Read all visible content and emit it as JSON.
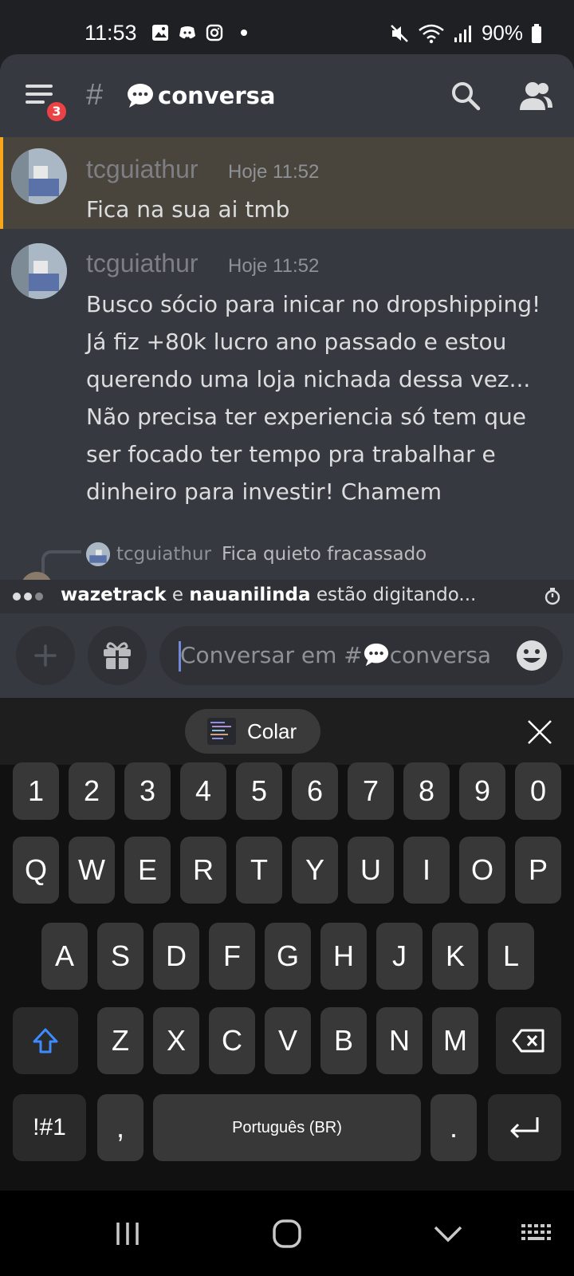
{
  "status_bar": {
    "time": "11:53",
    "battery": "90%"
  },
  "header": {
    "badge_count": "3",
    "hash": "#",
    "channel_name": "conversa"
  },
  "messages": [
    {
      "author": "tcguiathur",
      "time": "Hoje 11:52",
      "text": "Fica na sua ai tmb",
      "highlighted": true
    },
    {
      "author": "tcguiathur",
      "time": "Hoje 11:52",
      "lines": [
        "Busco sócio para inicar no dropshipping!",
        "Já fiz +80k lucro ano passado e estou",
        "querendo uma loja nichada dessa vez...",
        "Não precisa ter experiencia só tem que",
        "ser focado ter tempo pra trabalhar e",
        "dinheiro para investir! Chamem"
      ]
    }
  ],
  "reply": {
    "author": "tcguiathur",
    "text": "Fica quieto fracassado"
  },
  "typing": {
    "user1": "wazetrack",
    "joiner": "e",
    "user2": "nauanilinda",
    "suffix": "estão digitando..."
  },
  "composer": {
    "placeholder_prefix": "Conversar em #",
    "placeholder_channel": "conversa"
  },
  "clipboard": {
    "paste_label": "Colar"
  },
  "keyboard": {
    "row_numbers": [
      "1",
      "2",
      "3",
      "4",
      "5",
      "6",
      "7",
      "8",
      "9",
      "0"
    ],
    "row_q": [
      "Q",
      "W",
      "E",
      "R",
      "T",
      "Y",
      "U",
      "I",
      "O",
      "P"
    ],
    "row_a": [
      "A",
      "S",
      "D",
      "F",
      "G",
      "H",
      "J",
      "K",
      "L"
    ],
    "row_z": [
      "Z",
      "X",
      "C",
      "V",
      "B",
      "N",
      "M"
    ],
    "symbols_label": "!#1",
    "comma": ",",
    "space_label": "Português (BR)",
    "period": "."
  },
  "colors": {
    "accent": "#7289da",
    "mention_highlight": "#faa61a",
    "badge": "#ed4245",
    "shift_icon": "#3d8bff"
  }
}
